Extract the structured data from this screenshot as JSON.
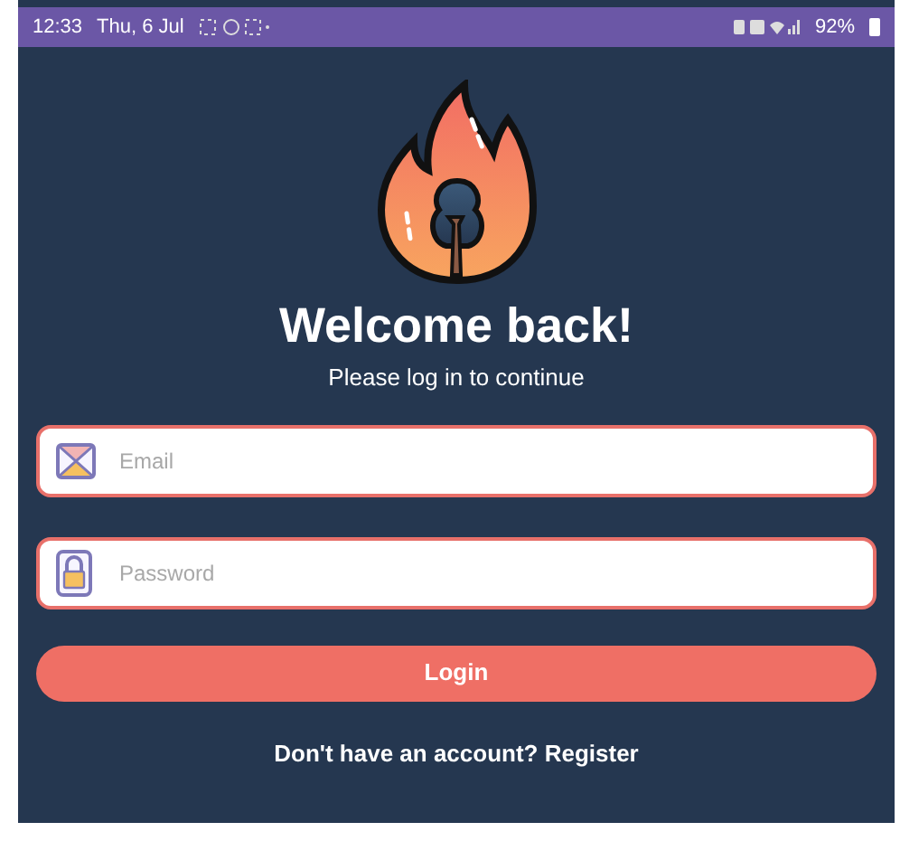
{
  "status_bar": {
    "time": "12:33",
    "date": "Thu, 6 Jul",
    "battery": "92%"
  },
  "header": {
    "title": "Welcome back!",
    "subtitle": "Please log in to continue"
  },
  "fields": [
    {
      "kind": "email",
      "placeholder": "Email"
    },
    {
      "kind": "password",
      "placeholder": "Password"
    }
  ],
  "login_button": "Login",
  "register_link": "Don't have an account? Register"
}
